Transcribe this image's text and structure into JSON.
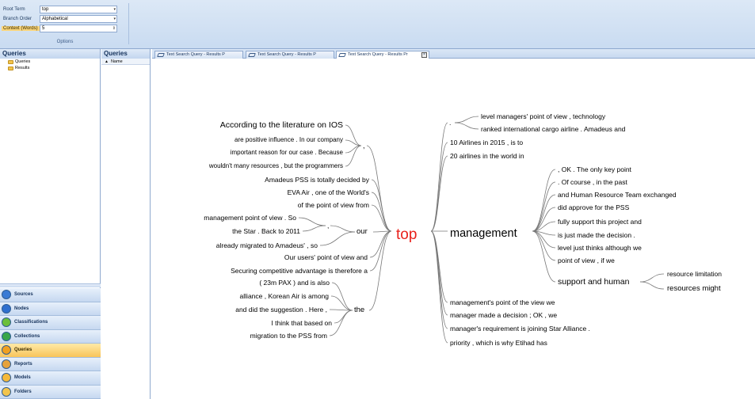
{
  "options": {
    "root_term_label": "Root Term",
    "root_term_value": "top",
    "branch_order_label": "Branch Order",
    "branch_order_value": "Alphabetical",
    "context_label": "Context (Words)",
    "context_value": "5",
    "caption": "Options"
  },
  "nav": {
    "title": "Queries",
    "tree": [
      "Queries",
      "Results"
    ],
    "buttons": [
      {
        "label": "Sources",
        "color": "#3a7bd5"
      },
      {
        "label": "Nodes",
        "color": "#2e6fcf"
      },
      {
        "label": "Classifications",
        "color": "#6bbf3a"
      },
      {
        "label": "Collections",
        "color": "#3aa64a"
      },
      {
        "label": "Queries",
        "color": "#f0a020",
        "active": true
      },
      {
        "label": "Reports",
        "color": "#e6a23c"
      },
      {
        "label": "Models",
        "color": "#f5b93a"
      },
      {
        "label": "Folders",
        "color": "#f2c44c"
      }
    ]
  },
  "list": {
    "title": "Queries",
    "column": "Name"
  },
  "tabs": [
    {
      "label": "Text Search Query - Results P"
    },
    {
      "label": "Text Search Query - Results P"
    },
    {
      "label": "Text Search Query - Results Pr",
      "active": true
    }
  ],
  "word_tree": {
    "root": "top",
    "root_color": "#e8201a",
    "left_top": [
      "According to the literature on IOS",
      "are positive influence . In our company",
      "important reason for our case . Because",
      "wouldn't many resources , but the programmers",
      "Amadeus PSS is totally decided by",
      "EVA Air , one of the World's",
      "of the point of view from"
    ],
    "comma_left": ",",
    "our_sub": [
      "management point of view . So",
      "the Star . Back to 2011",
      "already migrated to Amadeus' , so"
    ],
    "our_sub_comma": ",",
    "our": "our",
    "left_mid": [
      "Our users' point of view and",
      "Securing competitive advantage is therefore a"
    ],
    "the_sub": [
      "( 23m PAX ) and is also",
      "alliance , Korean Air is among",
      "and did the suggestion . Here ,",
      "I think that based on",
      "migration to the PSS from"
    ],
    "the": "the",
    "right_dot": ".",
    "right_dot_sub": [
      "level managers' point of view , technology",
      "ranked international cargo airline . Amadeus and"
    ],
    "right_top": [
      "10 Airlines in 2015 , is to",
      "20 airlines in the world in"
    ],
    "management": "management",
    "management_sub": [
      ", OK . The only key point",
      ". Of course , in the past",
      "and Human Resource Team exchanged",
      "did approve for the PSS",
      "fully support this project and",
      "is just made the decision .",
      "level just thinks although we",
      "point of view , if we"
    ],
    "support": "support and human",
    "support_sub": [
      "resource limitation",
      "resources might"
    ],
    "right_bottom": [
      "management's point of the view we",
      "manager made a decision ; OK , we",
      "manager's requirement is joining Star Alliance .",
      "priority , which is why Etihad has"
    ]
  }
}
